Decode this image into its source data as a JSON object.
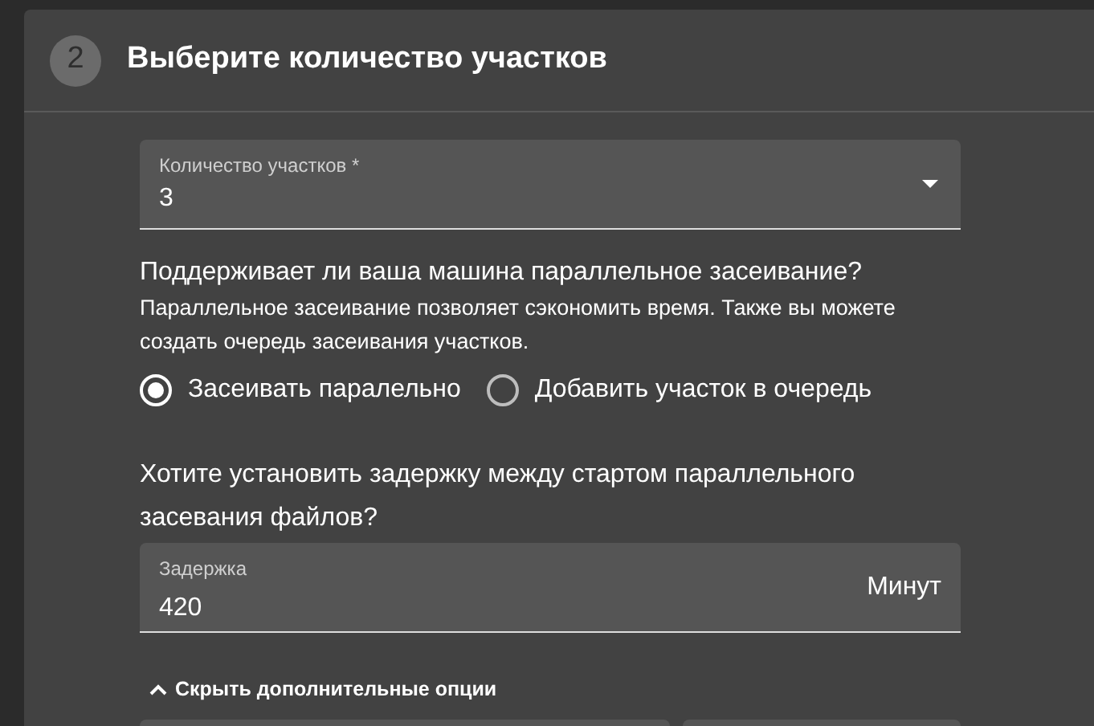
{
  "step": {
    "number": "2",
    "title": "Выберите количество участков"
  },
  "count_field": {
    "label": "Количество участков *",
    "value": "3"
  },
  "parallel": {
    "question": "Поддерживает ли ваша машина параллельное засеивание?",
    "hint": "Параллельное засеивание позволяет сэкономить время. Также вы можете создать очередь засеивания участков.",
    "options": [
      {
        "label": "Засеивать паралельно",
        "selected": true
      },
      {
        "label": "Добавить участок в очередь",
        "selected": false
      }
    ]
  },
  "delay": {
    "question": "Хотите установить задержку между стартом параллельного засевания файлов?",
    "label": "Задержка",
    "value": "420",
    "suffix": "Минут"
  },
  "options_toggle": {
    "label": "Скрыть дополнительные опции",
    "expanded": true
  }
}
